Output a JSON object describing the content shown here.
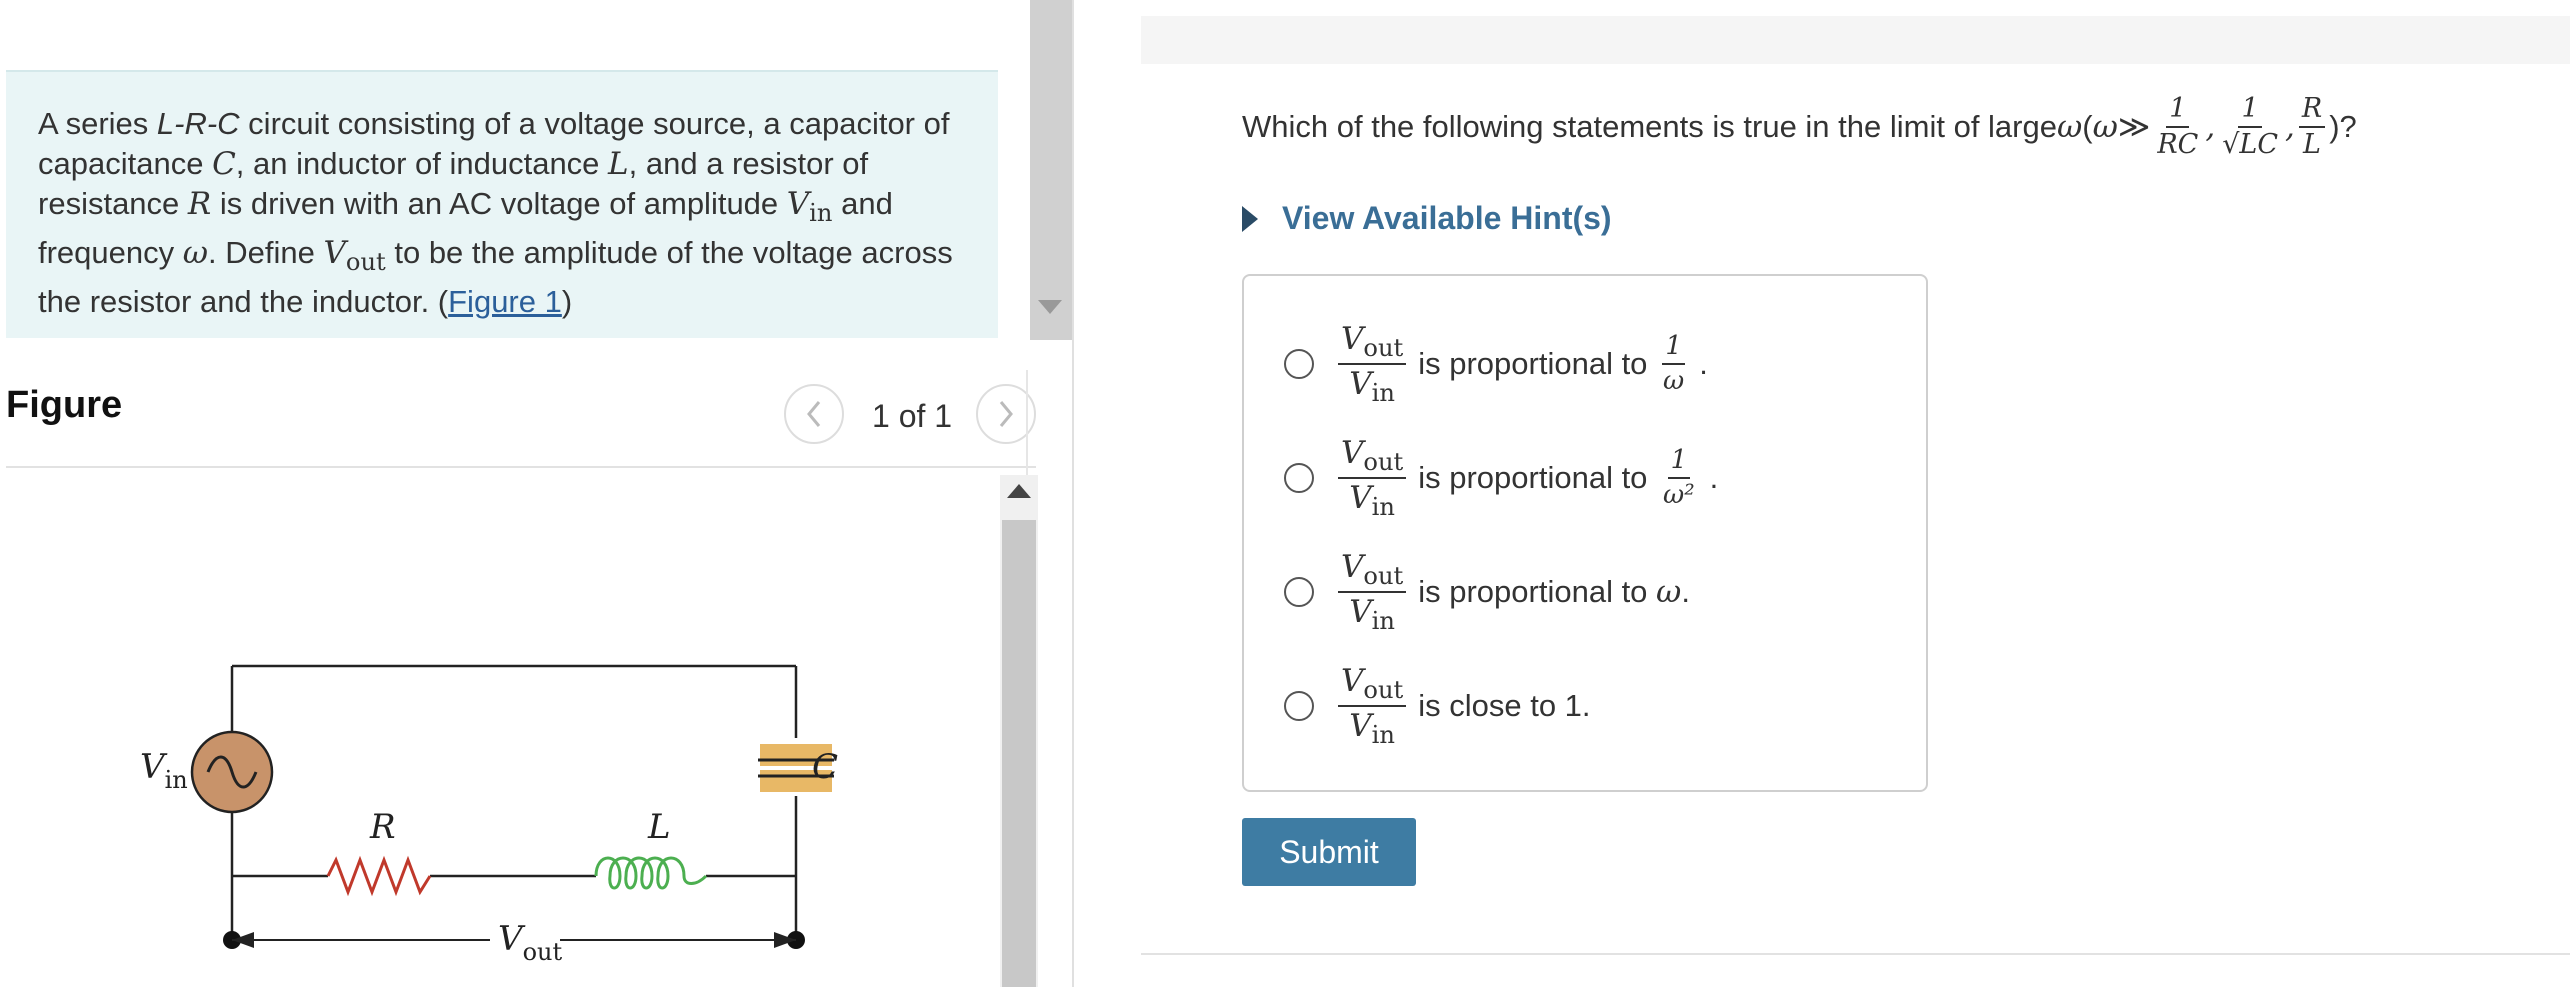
{
  "intro": {
    "segments": [
      {
        "t": "A series ",
        "k": "text"
      },
      {
        "t": "L-R-C",
        "k": "it"
      },
      {
        "t": " circuit consisting of a voltage source, a capacitor of capacitance ",
        "k": "text"
      },
      {
        "t": "C",
        "k": "m"
      },
      {
        "t": ", an inductor of inductance ",
        "k": "text"
      },
      {
        "t": "L",
        "k": "m"
      },
      {
        "t": ", and a resistor of resistance ",
        "k": "text"
      },
      {
        "t": "R",
        "k": "m"
      },
      {
        "t": " is driven with an AC voltage of amplitude ",
        "k": "text"
      },
      {
        "t": "V",
        "k": "m"
      },
      {
        "t": "in",
        "k": "sub"
      },
      {
        "t": " and frequency ",
        "k": "text"
      },
      {
        "t": "ω",
        "k": "m"
      },
      {
        "t": ". Define ",
        "k": "text"
      },
      {
        "t": "V",
        "k": "m"
      },
      {
        "t": "out",
        "k": "sub"
      },
      {
        "t": " to be the amplitude of the voltage across the resistor and the inductor. (",
        "k": "text"
      },
      {
        "t": "Figure 1",
        "k": "link"
      },
      {
        "t": ")",
        "k": "text"
      }
    ]
  },
  "figure": {
    "heading": "Figure",
    "pager": "1 of 1",
    "labels": {
      "vin": "V",
      "vin_sub": "in",
      "r": "R",
      "l": "L",
      "c": "C",
      "vout": "V",
      "vout_sub": "out"
    }
  },
  "question": {
    "prefix": "Which of the following statements is true in the limit of large ",
    "omega": "ω",
    "paren_open": " (",
    "gg": " ≫ ",
    "f1_num": "1",
    "f1_den": "RC",
    "f2_num": "1",
    "f2_den": "√LC",
    "f3_num": "R",
    "f3_den": "L",
    "comma": ",",
    "suffix": ")?"
  },
  "hint": {
    "label": "View Available Hint(s)"
  },
  "options": {
    "ratio_num": "V",
    "ratio_num_sub": "out",
    "ratio_den": "V",
    "ratio_den_sub": "in",
    "o1_text": "is proportional to",
    "o1_num": "1",
    "o1_den": "ω",
    "o1_end": ".",
    "o2_text": "is proportional to",
    "o2_num": "1",
    "o2_den": "ω²",
    "o2_end": ".",
    "o3_text": "is proportional to",
    "o3_var": "ω",
    "o3_end": ".",
    "o4_text": "is close to 1."
  },
  "submit": {
    "label": "Submit"
  },
  "colors": {
    "intro_bg": "#e9f5f6",
    "submit_bg": "#3e7ca3",
    "hint": "#3a6e96",
    "resistor": "#c0392b",
    "inductor": "#4caf50",
    "capacitor": "#e8b866",
    "source": "#c8936a"
  }
}
